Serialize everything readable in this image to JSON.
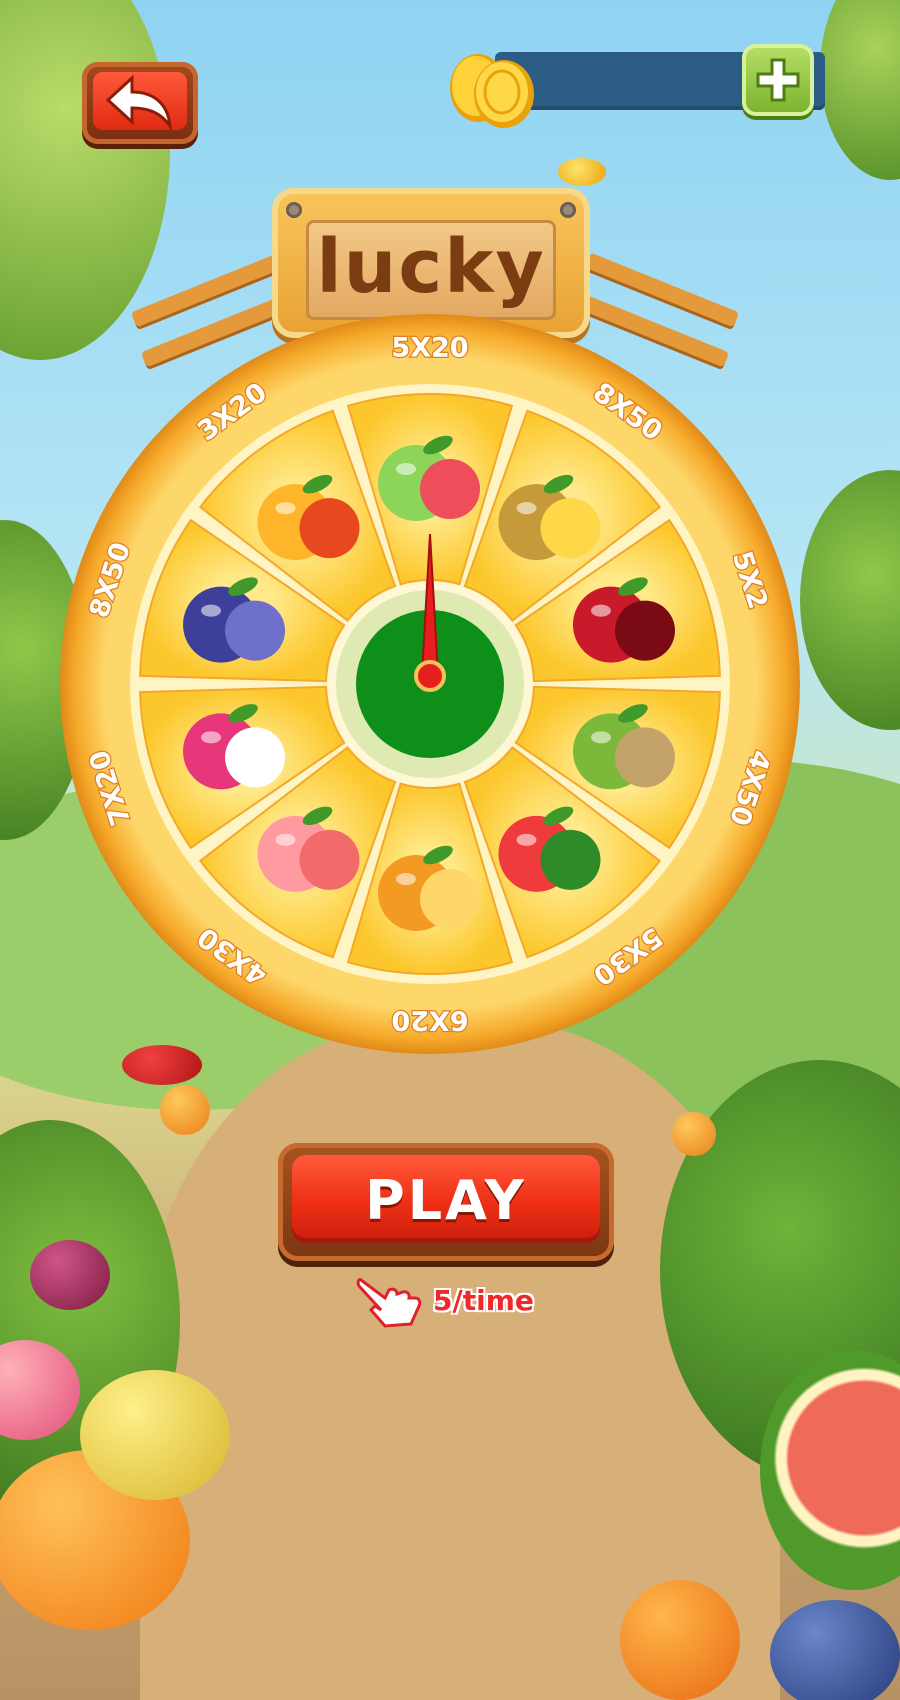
{
  "header": {
    "back_icon": "back-arrow-icon",
    "coin_icon": "gold-coins-icon",
    "coin_balance": "",
    "add_icon": "plus-icon"
  },
  "sign": {
    "title": "lucky"
  },
  "wheel": {
    "pointer_icon": "red-needle-icon",
    "segments": [
      {
        "label": "5X20",
        "fruit": "guava"
      },
      {
        "label": "8X50",
        "fruit": "durian"
      },
      {
        "label": "5X2",
        "fruit": "cherry"
      },
      {
        "label": "4X50",
        "fruit": "kiwi"
      },
      {
        "label": "5X30",
        "fruit": "strawberry"
      },
      {
        "label": "6X20",
        "fruit": "orange"
      },
      {
        "label": "4X30",
        "fruit": "peach"
      },
      {
        "label": "7X20",
        "fruit": "dragon-fruit"
      },
      {
        "label": "8X50",
        "fruit": "blueberry"
      },
      {
        "label": "3X20",
        "fruit": "mango"
      }
    ]
  },
  "play": {
    "label": "PLAY",
    "cost_icon": "pointing-hand-icon",
    "cost": "5/time"
  },
  "colors": {
    "wheel_outer": "#f7b23b",
    "wheel_inner": "#fde06b",
    "hub": "#0e8f1a",
    "play_red": "#ee2e15",
    "cost_red": "#f0282a"
  }
}
